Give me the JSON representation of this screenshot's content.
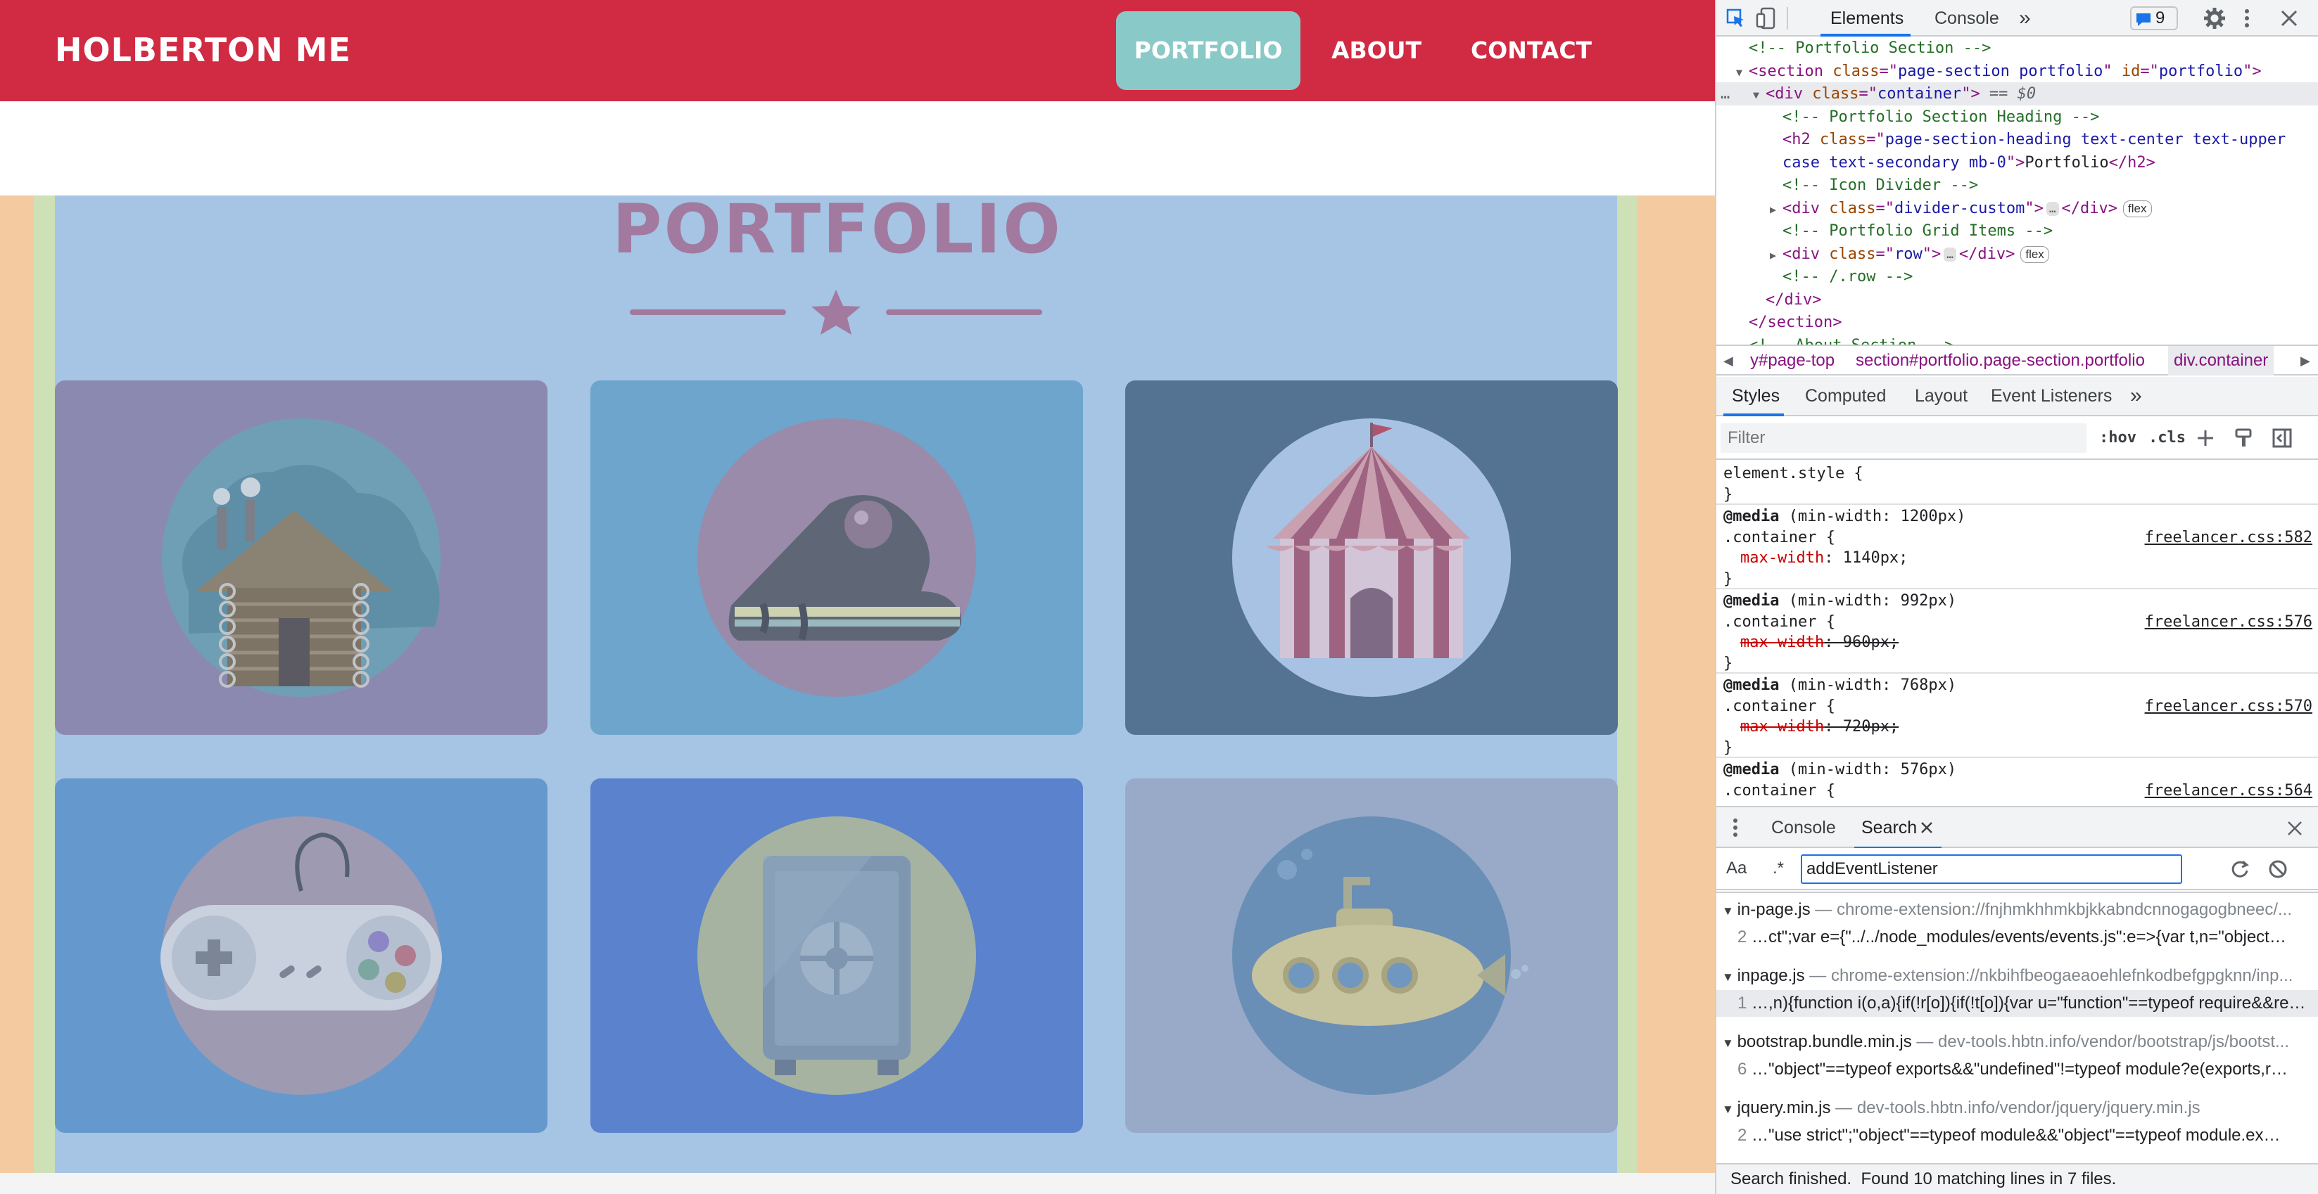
{
  "page": {
    "brand": "HOLBERTON ME",
    "nav": [
      {
        "label": "PORTFOLIO",
        "active": true
      },
      {
        "label": "ABOUT",
        "active": false
      },
      {
        "label": "CONTACT",
        "active": false
      }
    ],
    "heading": "PORTFOLIO",
    "colors": {
      "navbar": "#d12a43",
      "active_nav": "#89c9c7",
      "container_overlay": "#a6c4e3",
      "padding_overlay": "#f4cba0",
      "heading": "#a27a9f"
    },
    "portfolio_items": [
      {
        "name": "cabin",
        "icon": "cabin-icon"
      },
      {
        "name": "cake",
        "icon": "cake-icon"
      },
      {
        "name": "circus",
        "icon": "circus-tent-icon"
      },
      {
        "name": "game",
        "icon": "game-controller-icon"
      },
      {
        "name": "safe",
        "icon": "safe-icon"
      },
      {
        "name": "submarine",
        "icon": "submarine-icon"
      }
    ]
  },
  "devtools": {
    "tabs": {
      "elements": "Elements",
      "console": "Console",
      "more": "»"
    },
    "issues_count": "9",
    "dom_lines": [
      {
        "indent": 1,
        "type": "comment",
        "text": "<!-- Portfolio Section -->"
      },
      {
        "indent": 1,
        "type": "open",
        "arrow": "▼",
        "tag": "section",
        "attrs": [
          [
            "class",
            "page-section portfolio"
          ],
          [
            "id",
            "portfolio"
          ]
        ],
        "suffix": ""
      },
      {
        "indent": 2,
        "type": "open",
        "arrow": "▼",
        "tag": "div",
        "attrs": [
          [
            "class",
            "container"
          ]
        ],
        "suffix": " == $0",
        "selected": true
      },
      {
        "indent": 3,
        "type": "comment",
        "text": "<!-- Portfolio Section Heading -->"
      },
      {
        "indent": 3,
        "type": "raw",
        "text": "<h2 class=\"page-section-heading text-center text-upper"
      },
      {
        "indent": 3,
        "type": "raw2",
        "text": "case text-secondary mb-0\">Portfolio</h2>"
      },
      {
        "indent": 3,
        "type": "comment",
        "text": "<!-- Icon Divider -->"
      },
      {
        "indent": 3,
        "type": "collapsed",
        "arrow": "▶",
        "tag": "div",
        "attrs": [
          [
            "class",
            "divider-custom"
          ]
        ],
        "badge": "flex"
      },
      {
        "indent": 3,
        "type": "comment",
        "text": "<!-- Portfolio Grid Items -->"
      },
      {
        "indent": 3,
        "type": "collapsed",
        "arrow": "▶",
        "tag": "div",
        "attrs": [
          [
            "class",
            "row"
          ]
        ],
        "badge": "flex"
      },
      {
        "indent": 3,
        "type": "comment",
        "text": "<!-- /.row -->"
      },
      {
        "indent": 2,
        "type": "close",
        "text": "</div>"
      },
      {
        "indent": 1,
        "type": "close",
        "text": "</section>"
      },
      {
        "indent": 1,
        "type": "comment",
        "text": "<!-- About Section -->"
      }
    ],
    "breadcrumbs": [
      "y#page-top",
      "section#portfolio.page-section.portfolio",
      "div.container"
    ],
    "styles_tabs": [
      "Styles",
      "Computed",
      "Layout",
      "Event Listeners",
      "»"
    ],
    "filter_placeholder": "Filter",
    "hov": ":hov",
    "cls": ".cls",
    "css_rules": [
      {
        "lines": [
          "element.style {",
          "}"
        ],
        "source": ""
      },
      {
        "lines": [
          "@media (min-width: 1200px)",
          ".container {",
          "  max-width: 1140px;",
          "}"
        ],
        "source": "freelancer.css:582",
        "struck": false
      },
      {
        "lines": [
          "@media (min-width: 992px)",
          ".container {",
          "  max-width: 960px;",
          "}"
        ],
        "source": "freelancer.css:576",
        "struck": true
      },
      {
        "lines": [
          "@media (min-width: 768px)",
          ".container {",
          "  max-width: 720px;",
          "}"
        ],
        "source": "freelancer.css:570",
        "struck": true
      },
      {
        "lines": [
          "@media (min-width: 576px)",
          ".container {"
        ],
        "source": "freelancer.css:564",
        "struck": true
      }
    ],
    "drawer_tabs": {
      "console": "Console",
      "search": "Search"
    },
    "search": {
      "case_label": "Aa",
      "regex_label": ".*",
      "query": "addEventListener",
      "results": [
        {
          "file": "in-page.js",
          "path": "chrome-extension://fnjhmkhhmkbjkkabndcnnogagogbneec/...",
          "line_no": "2",
          "line": "…ct\";var e={\"../../node_modules/events/events.js\":e=>{var t,n=\"object…",
          "highlighted": false
        },
        {
          "file": "inpage.js",
          "path": "chrome-extension://nkbihfbeogaeaoehlefnkodbefgpgknn/inp...",
          "line_no": "1",
          "line": "…,n){function i(o,a){if(!r[o]){if(!t[o]){var u=\"function\"==typeof require&&re…",
          "highlighted": true
        },
        {
          "file": "bootstrap.bundle.min.js",
          "path": "dev-tools.hbtn.info/vendor/bootstrap/js/bootst...",
          "line_no": "6",
          "line": "…\"object\"==typeof exports&&\"undefined\"!=typeof module?e(exports,r…",
          "highlighted": false
        },
        {
          "file": "jquery.min.js",
          "path": "dev-tools.hbtn.info/vendor/jquery/jquery.min.js",
          "line_no": "2",
          "line": "…\"use strict\";\"object\"==typeof module&&\"object\"==typeof module.ex…",
          "highlighted": false
        }
      ],
      "status": "Search finished.  Found 10 matching lines in 7 files."
    }
  }
}
